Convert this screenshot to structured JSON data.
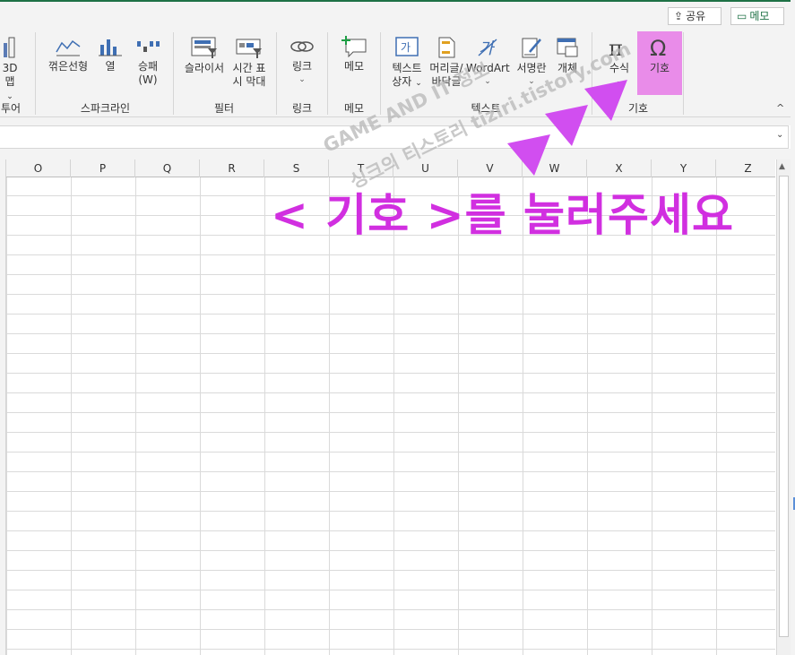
{
  "ribbon": {
    "share_label": "공유",
    "memo_button_label": "메모",
    "commands": {
      "map3d_line1": "3D",
      "map3d_line2": "맵",
      "line": "꺾은선형",
      "column": "열",
      "winloss_line1": "승패",
      "winloss_line2": "(W)",
      "slicer": "슬라이서",
      "timeline_line1": "시간 표",
      "timeline_line2": "시 막대",
      "link": "링크",
      "memo": "메모",
      "textbox_line1": "텍스트",
      "textbox_line2": "상자",
      "header_line1": "머리글/",
      "header_line2": "바닥글",
      "wordart": "WordArt",
      "signature": "서명란",
      "object": "개체",
      "equation": "수식",
      "symbol": "기호"
    },
    "groups": {
      "tour": "투어",
      "sparklines": "스파크라인",
      "filter": "필터",
      "links": "링크",
      "comments": "메모",
      "text": "텍스트",
      "symbols": "기호"
    }
  },
  "sheet": {
    "columns": [
      "O",
      "P",
      "Q",
      "R",
      "S",
      "T",
      "U",
      "V",
      "W",
      "X",
      "Y",
      "Z"
    ]
  },
  "overlay": {
    "instruction": "< 기호 >를 눌러주세요",
    "watermark_line1": "GAME AND IT 정보",
    "watermark_line2": "싱크의 티스토리 tiziri.tistory.com",
    "highlight_color": "#e98ce9",
    "arrow_color": "#d14ef0",
    "text_color": "#d12fe0"
  }
}
